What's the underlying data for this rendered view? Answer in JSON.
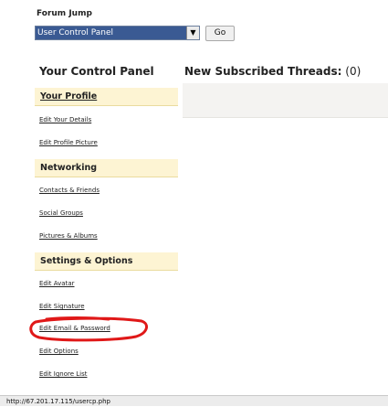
{
  "forum_jump": {
    "label": "Forum Jump",
    "selected": "User Control Panel",
    "dropdown_icon": "triangle-down-icon",
    "go_label": "Go"
  },
  "control_panel": {
    "title": "Your Control Panel"
  },
  "subscribed": {
    "title": "New Subscribed Threads",
    "count": "(0)"
  },
  "sidebar": {
    "your_profile": {
      "title": "Your Profile",
      "links": [
        "Edit Your Details",
        "Edit Profile Picture"
      ]
    },
    "networking": {
      "title": "Networking",
      "links": [
        "Contacts & Friends",
        "Social Groups",
        "Pictures & Albums"
      ]
    },
    "settings": {
      "title": "Settings & Options",
      "links": [
        "Edit Avatar",
        "Edit Signature",
        "Edit Email & Password",
        "Edit Options",
        "Edit Ignore List"
      ]
    }
  },
  "annotation": {
    "color": "#e01818",
    "highlights": "Edit Email & Password"
  },
  "colors": {
    "select_highlight": "#3a5a93",
    "section_header_bg": "#fdf4d3",
    "panel_bg": "#f4f3f1"
  },
  "status_bar": {
    "url": "http://67.201.17.115/usercp.php"
  }
}
